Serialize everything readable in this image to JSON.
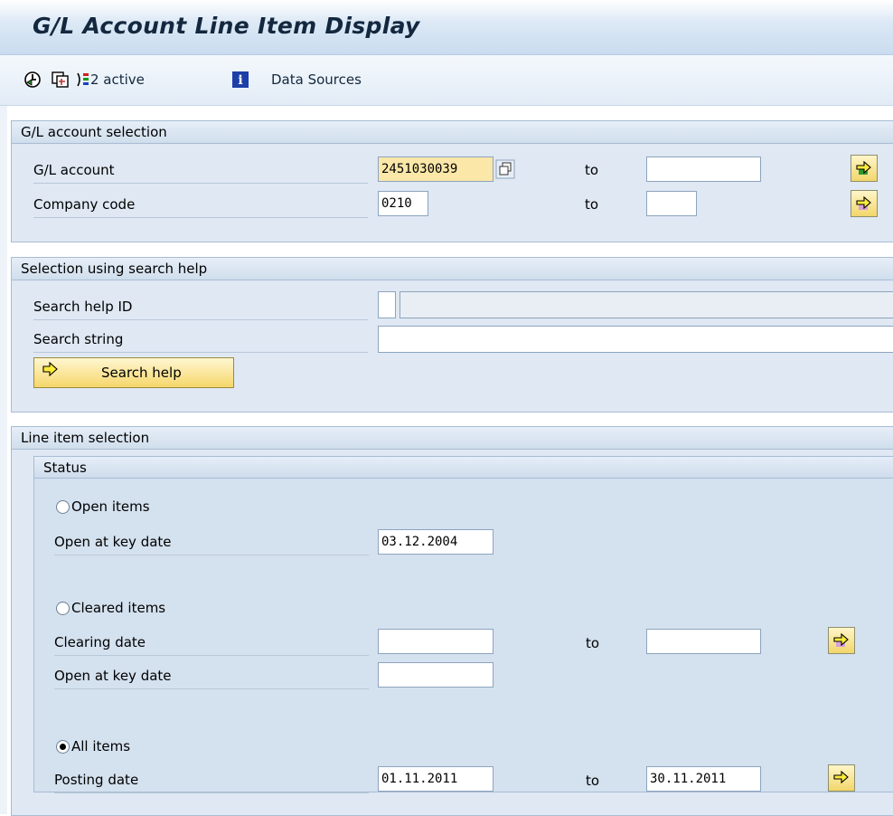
{
  "title": "G/L Account Line Item Display",
  "toolbar": {
    "active_label": "2 active",
    "data_sources_label": "Data Sources"
  },
  "gl_selection": {
    "heading": "G/L account selection",
    "gl_account_label": "G/L account",
    "gl_account_value": "2451030039",
    "company_code_label": "Company code",
    "company_code_value": "0210",
    "to_label": "to"
  },
  "search_help": {
    "heading": "Selection using search help",
    "id_label": "Search help ID",
    "string_label": "Search string",
    "button_label": "Search help"
  },
  "line_items": {
    "heading": "Line item selection",
    "status_heading": "Status",
    "open_items_label": "Open items",
    "open_key_date_label": "Open at key date",
    "open_key_date_value": "03.12.2004",
    "cleared_items_label": "Cleared items",
    "clearing_date_label": "Clearing date",
    "cleared_key_date_label": "Open at key date",
    "all_items_label": "All items",
    "posting_date_label": "Posting date",
    "posting_from": "01.11.2011",
    "posting_to": "30.11.2011",
    "to_label": "to",
    "selected_status": "All items"
  },
  "icons": [
    "execute-icon",
    "variant-icon",
    "dynamic-selections-icon",
    "info-icon",
    "multiple-selection-icon",
    "matchcode-icon"
  ],
  "colors": {
    "required_field": "#fbe7a8",
    "panel": "#dfe8f3"
  }
}
